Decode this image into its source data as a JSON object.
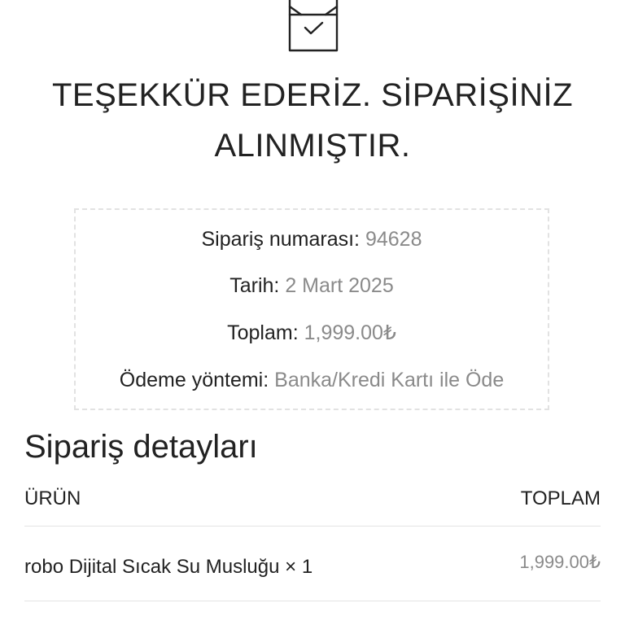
{
  "header": {
    "icon": "package-check-icon",
    "title_line1": "TEŞEKKÜR EDERİZ. SİPARİŞİNİZ",
    "title_line2": "ALINMIŞTIR."
  },
  "summary": {
    "order_number_label": "Sipariş numarası:",
    "order_number_value": "94628",
    "date_label": "Tarih:",
    "date_value": "2 Mart 2025",
    "total_label": "Toplam:",
    "total_value": "1,999.00₺",
    "payment_label": "Ödeme yöntemi:",
    "payment_value": "Banka/Kredi Kartı ile Öde"
  },
  "details": {
    "title": "Sipariş detayları",
    "columns": {
      "product": "ÜRÜN",
      "total": "TOPLAM"
    },
    "items": [
      {
        "name": "robo Dijital Sıcak Su Musluğu × 1",
        "total": "1,999.00₺"
      }
    ]
  },
  "colors": {
    "text": "#222222",
    "muted": "#8a8a8a",
    "border": "#e2e2e2"
  }
}
